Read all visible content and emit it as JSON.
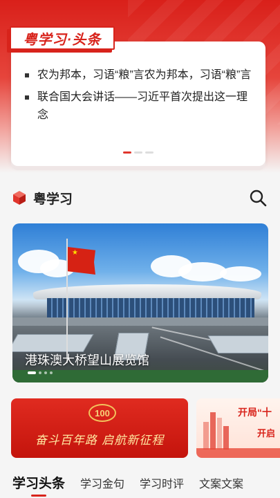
{
  "headline_card": {
    "badge_text": "粤学习·头条",
    "items": [
      "农为邦本，习语“粮”言农为邦本，习语“粮”言",
      "联合国大会讲话——习近平首次提出这一理念"
    ],
    "pager_count": 3,
    "pager_active": 0
  },
  "section": {
    "title": "粤学习",
    "icon": "cube-icon",
    "search_icon": "search-icon"
  },
  "banner": {
    "caption": "港珠澳大桥望山展览馆",
    "active_slide": 0,
    "slide_count": 4
  },
  "promos": [
    {
      "logo_text": "100",
      "slogan": "奋斗百年路 启航新征程"
    },
    {
      "line1": "开局“十",
      "line2": "开启"
    }
  ],
  "tabs": [
    {
      "label": "学习头条",
      "active": true
    },
    {
      "label": "学习金句",
      "active": false
    },
    {
      "label": "学习时评",
      "active": false
    },
    {
      "label": "文案文案",
      "active": false
    }
  ],
  "colors": {
    "brand_red": "#d8231b",
    "background": "#f5f5f5"
  }
}
